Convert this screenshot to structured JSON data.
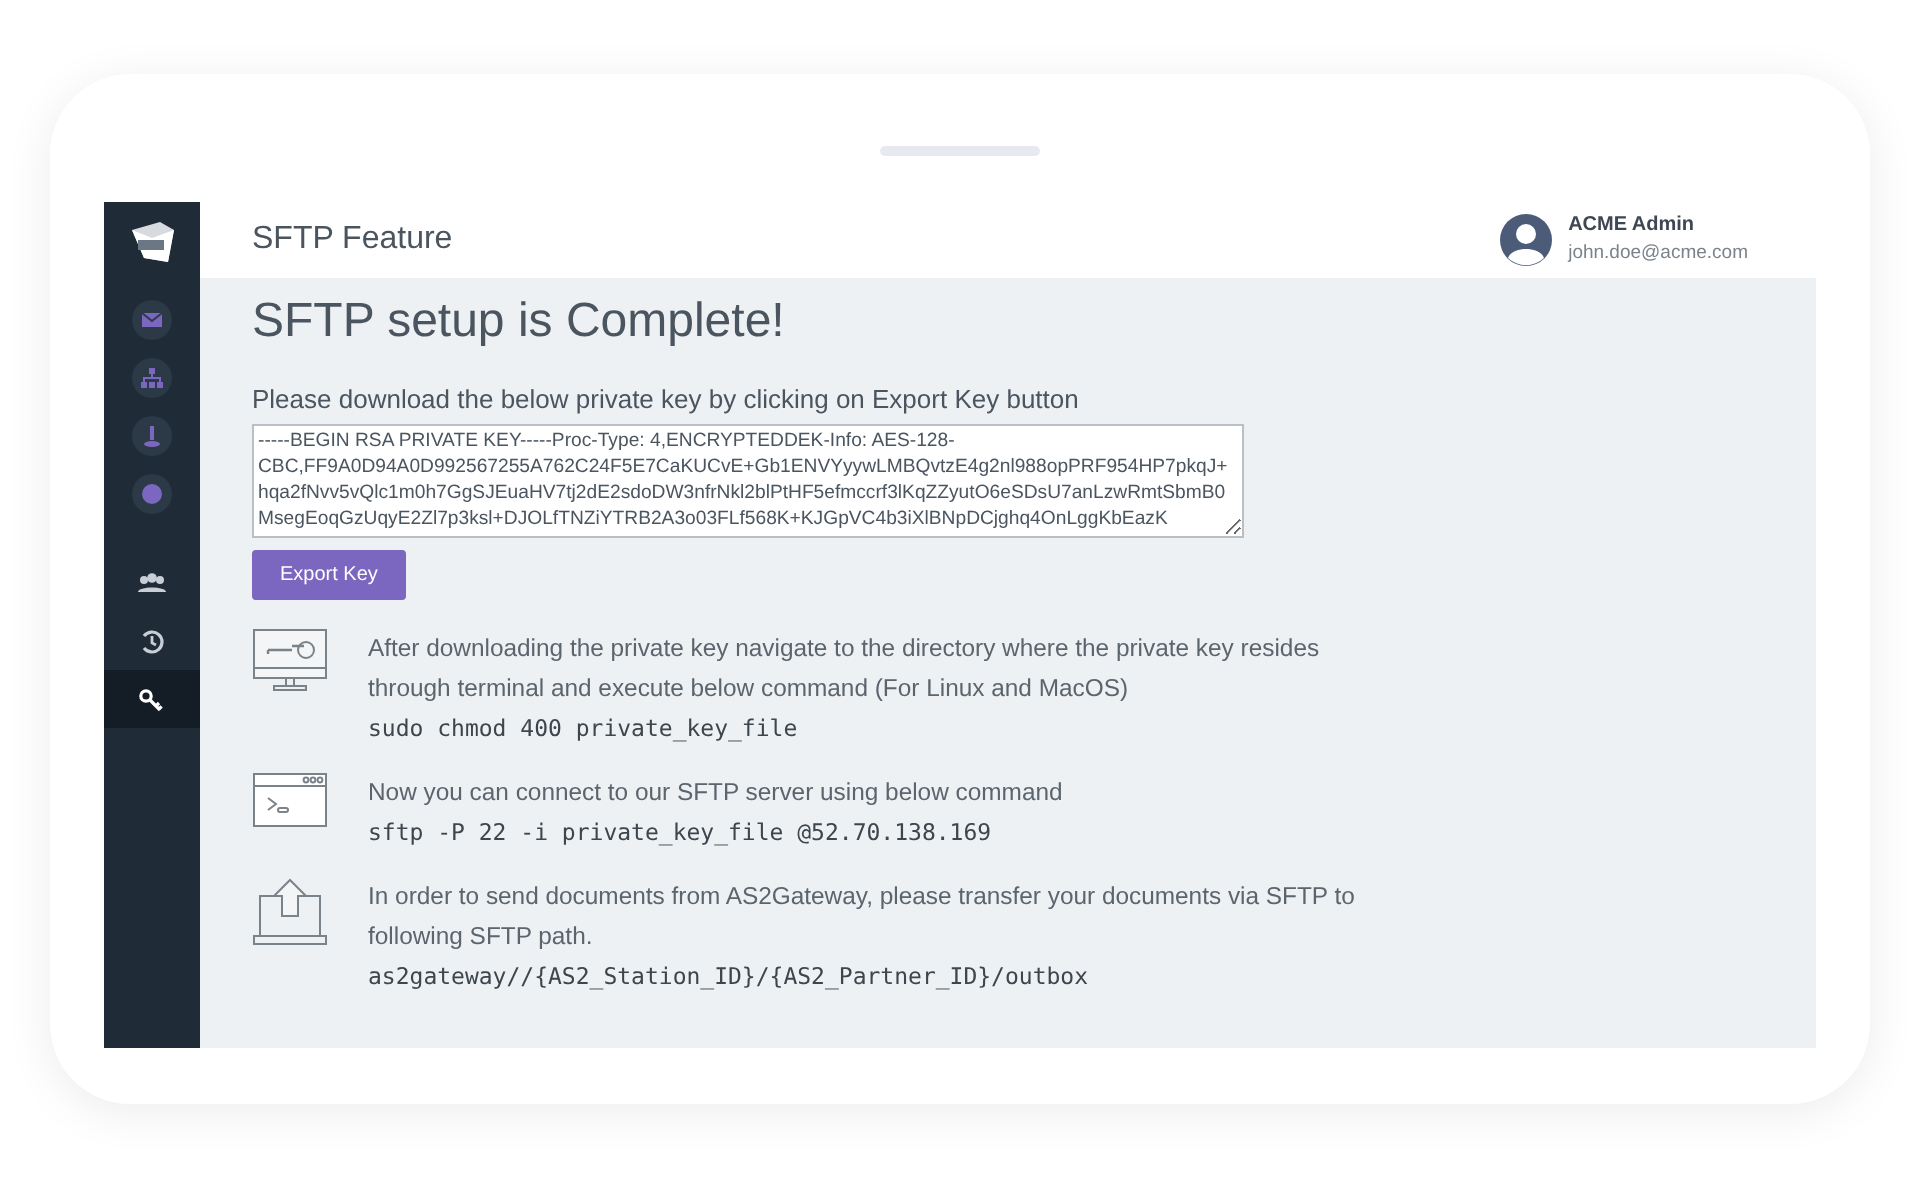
{
  "sidebar": {
    "items": [
      {
        "kind": "envelope",
        "selected": false
      },
      {
        "kind": "sitemap",
        "selected": false
      },
      {
        "kind": "upload",
        "selected": false
      },
      {
        "kind": "circle",
        "selected": false
      },
      {
        "kind": "users",
        "selected": false
      },
      {
        "kind": "history",
        "selected": false
      },
      {
        "kind": "key",
        "selected": true
      }
    ]
  },
  "header": {
    "title": "SFTP Feature",
    "user_name": "ACME Admin",
    "user_email": "john.doe@acme.com"
  },
  "content": {
    "heading": "SFTP setup is Complete!",
    "instruction": "Please download the below private key by clicking on Export Key button",
    "private_key": "-----BEGIN RSA PRIVATE KEY-----Proc-Type: 4,ENCRYPTEDDEK-Info: AES-128-CBC,FF9A0D94A0D992567255A762C24F5E7CaKUCvE+Gb1ENVYyywLMBQvtzE4g2nl988opPRF954HP7pkqJ+hqa2fNvv5vQlc1m0h7GgSJEuaHV7tj2dE2sdoDW3nfrNkl2blPtHF5efmccrf3lKqZZyutO6eSDsU7anLzwRmtSbmB0MsegEoqGzUqyE2Zl7p3ksl+DJOLfTNZiYTRB2A3o03FLf568K+KJGpVC4b3iXlBNpDCjghq4OnLggKbEazK",
    "export_button": "Export Key",
    "steps": [
      {
        "kind": "monitor-key",
        "text": "After downloading the private key navigate to the directory where the private key resides through terminal and execute below command (For Linux and MacOS)",
        "command": "sudo chmod 400 private_key_file"
      },
      {
        "kind": "terminal",
        "text": "Now you can connect to our SFTP server using below command",
        "command": "sftp -P 22 -i private_key_file @52.70.138.169"
      },
      {
        "kind": "laptop-upload",
        "text": "In order to send documents from AS2Gateway, please transfer your documents via SFTP to following SFTP path.",
        "command": "as2gateway//{AS2_Station_ID}/{AS2_Partner_ID}/outbox"
      }
    ]
  }
}
